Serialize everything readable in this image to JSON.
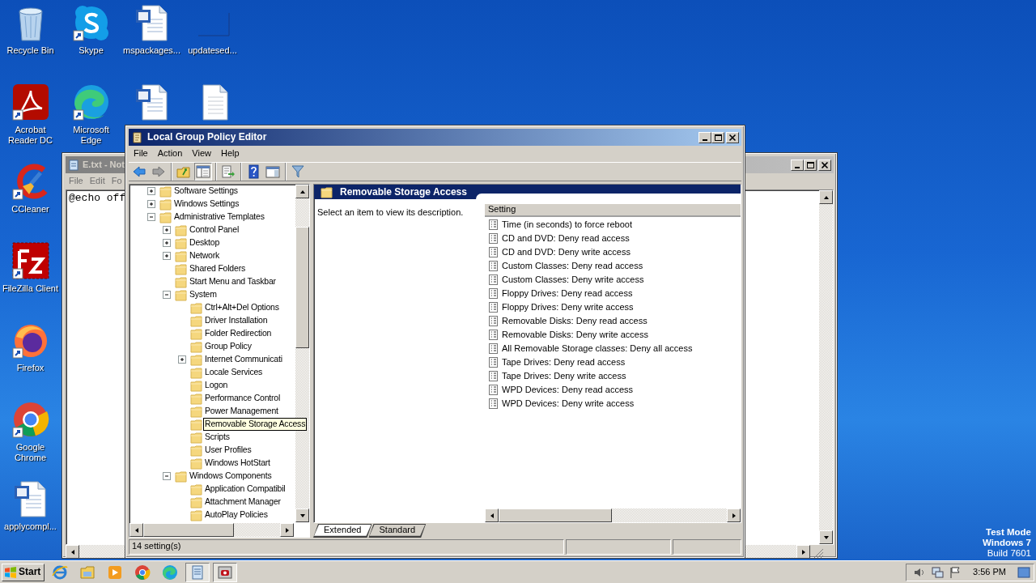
{
  "desktop": {
    "columns": [
      {
        "icons": [
          {
            "kind": "recycle",
            "label": "Recycle Bin",
            "shortcut": false
          },
          {
            "kind": "acrobat",
            "label": "Acrobat Reader DC",
            "shortcut": true
          },
          {
            "kind": "ccleaner",
            "label": "CCleaner",
            "shortcut": true
          },
          {
            "kind": "filezilla",
            "label": "FileZilla Client",
            "shortcut": true
          },
          {
            "kind": "firefox",
            "label": "Firefox",
            "shortcut": true
          },
          {
            "kind": "chrome",
            "label": "Google Chrome",
            "shortcut": true
          },
          {
            "kind": "word",
            "label": "applycompl...",
            "shortcut": false
          }
        ]
      },
      {
        "icons": [
          {
            "kind": "skype",
            "label": "Skype",
            "shortcut": true
          },
          {
            "kind": "edge",
            "label": "Microsoft Edge",
            "shortcut": true
          }
        ]
      },
      {
        "icons": [
          {
            "kind": "word",
            "label": "mspackages...",
            "shortcut": false
          },
          {
            "kind": "word",
            "shortcut": false
          }
        ]
      },
      {
        "icons": [
          {
            "kind": "blank",
            "label": "updatesed...",
            "shortcut": false
          },
          {
            "kind": "text",
            "shortcut": false
          }
        ]
      }
    ]
  },
  "notepad": {
    "title": "E.txt - Not",
    "menu": [
      "File",
      "Edit",
      "Fo"
    ],
    "text": "@echo off"
  },
  "editor": {
    "title": "Local Group Policy Editor",
    "menu": [
      "File",
      "Action",
      "View",
      "Help"
    ],
    "toolbar_groups": [
      {
        "buttons": [
          {
            "kind": "back",
            "pressed": false
          },
          {
            "kind": "forward",
            "pressed": false
          }
        ]
      },
      {
        "buttons": [
          {
            "kind": "up",
            "pressed": false
          },
          {
            "kind": "tree",
            "pressed": true
          }
        ]
      },
      {
        "buttons": [
          {
            "kind": "export",
            "pressed": false
          }
        ]
      },
      {
        "buttons": [
          {
            "kind": "help",
            "pressed": false
          },
          {
            "kind": "view",
            "pressed": false
          }
        ]
      },
      {
        "buttons": [
          {
            "kind": "filter",
            "pressed": false
          }
        ]
      }
    ],
    "tree": [
      {
        "label": "Software Settings",
        "expanded": false,
        "selected": false
      },
      {
        "label": "Windows Settings",
        "expanded": false,
        "selected": false
      },
      {
        "label": "Administrative Templates",
        "expanded": true,
        "selected": false,
        "children": [
          {
            "label": "Control Panel",
            "expanded": false,
            "selected": false
          },
          {
            "label": "Desktop",
            "expanded": false,
            "selected": false
          },
          {
            "label": "Network",
            "expanded": false,
            "selected": false
          },
          {
            "label": "Shared Folders",
            "selected": false
          },
          {
            "label": "Start Menu and Taskbar",
            "selected": false
          },
          {
            "label": "System",
            "expanded": true,
            "selected": false,
            "children": [
              {
                "label": "Ctrl+Alt+Del Options",
                "selected": false
              },
              {
                "label": "Driver Installation",
                "selected": false
              },
              {
                "label": "Folder Redirection",
                "selected": false
              },
              {
                "label": "Group Policy",
                "selected": false
              },
              {
                "label": "Internet Communicati",
                "expanded": false,
                "selected": false
              },
              {
                "label": "Locale Services",
                "selected": false
              },
              {
                "label": "Logon",
                "selected": false
              },
              {
                "label": "Performance Control",
                "selected": false
              },
              {
                "label": "Power Management",
                "selected": false
              },
              {
                "label": "Removable Storage Access",
                "selected": true
              },
              {
                "label": "Scripts",
                "selected": false
              },
              {
                "label": "User Profiles",
                "selected": false
              },
              {
                "label": "Windows HotStart",
                "selected": false
              }
            ]
          },
          {
            "label": "Windows Components",
            "expanded": true,
            "selected": false,
            "children": [
              {
                "label": "Application Compatibil",
                "selected": false
              },
              {
                "label": "Attachment Manager",
                "selected": false
              },
              {
                "label": "AutoPlay Policies",
                "selected": false
              }
            ]
          }
        ]
      }
    ],
    "pane_title": "Removable Storage Access",
    "description": "Select an item to view its description.",
    "column": "Setting",
    "settings": [
      "Time (in seconds) to force reboot",
      "CD and DVD: Deny read access",
      "CD and DVD: Deny write access",
      "Custom Classes: Deny read access",
      "Custom Classes: Deny write access",
      "Floppy Drives: Deny read access",
      "Floppy Drives: Deny write access",
      "Removable Disks: Deny read access",
      "Removable Disks: Deny write access",
      "All Removable Storage classes: Deny all access",
      "Tape Drives: Deny read access",
      "Tape Drives: Deny write access",
      "WPD Devices: Deny read access",
      "WPD Devices: Deny write access"
    ],
    "tabs": [
      {
        "label": "Extended",
        "selected": true
      },
      {
        "label": "Standard",
        "selected": false
      }
    ],
    "status": "14 setting(s)"
  },
  "os_notice": [
    "Test Mode",
    "Windows 7",
    "Build 7601"
  ],
  "taskbar": {
    "start": "Start",
    "apps": [
      {
        "kind": "ie",
        "pressed": false
      },
      {
        "kind": "explorer",
        "pressed": false
      },
      {
        "kind": "media",
        "pressed": false
      },
      {
        "kind": "chrome",
        "pressed": false
      },
      {
        "kind": "edge",
        "pressed": false
      },
      {
        "kind": "notepad",
        "pressed": true
      },
      {
        "kind": "policy",
        "pressed": true
      }
    ],
    "clock": "3:56 PM"
  }
}
